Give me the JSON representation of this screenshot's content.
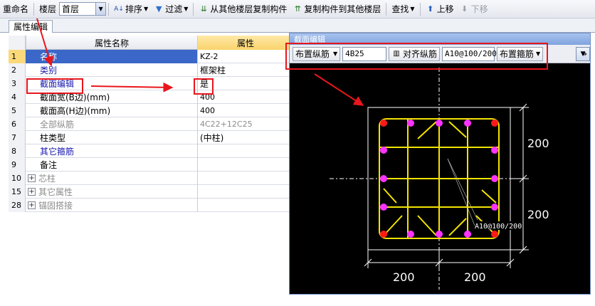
{
  "toolbar": {
    "rename": "重命名",
    "floor_label": "楼层",
    "floor_value": "首层",
    "sort": "排序",
    "filter": "过滤",
    "copy_from": "从其他楼层复制构件",
    "copy_to": "复制构件到其他楼层",
    "find": "查找",
    "move_up": "上移",
    "move_down": "下移"
  },
  "tab": {
    "label": "属性编辑"
  },
  "grid": {
    "header_name": "属性名称",
    "header_value": "属性",
    "rows": [
      {
        "no": "1",
        "name": "名称",
        "value": "KZ-2"
      },
      {
        "no": "2",
        "name": "类别",
        "value": "框架柱"
      },
      {
        "no": "3",
        "name": "截面编辑",
        "value": "是"
      },
      {
        "no": "4",
        "name": "截面宽(B边)(mm)",
        "value": "400"
      },
      {
        "no": "5",
        "name": "截面高(H边)(mm)",
        "value": "400"
      },
      {
        "no": "6",
        "name": "全部纵筋",
        "value": "4C22+12C25"
      },
      {
        "no": "7",
        "name": "柱类型",
        "value": "(中柱)"
      },
      {
        "no": "8",
        "name": "其它箍筋",
        "value": ""
      },
      {
        "no": "9",
        "name": "备注",
        "value": ""
      },
      {
        "no": "10",
        "name": "芯柱",
        "value": ""
      },
      {
        "no": "15",
        "name": "其它属性",
        "value": ""
      },
      {
        "no": "28",
        "name": "锚固搭接",
        "value": ""
      }
    ]
  },
  "editor": {
    "title": "截面编辑",
    "place_long_bar": "布置纵筋",
    "long_bar_value": "4B25",
    "align_long_bar": "对齐纵筋",
    "stirrup_value": "A10@100/200",
    "place_stirrup": "布置箍筋",
    "more": "»"
  },
  "drawing": {
    "dim_right_top": "200",
    "dim_right_bottom": "200",
    "dim_bottom_left": "200",
    "dim_bottom_right": "200",
    "stirrup_label": "A10@100/200",
    "colors": {
      "stirrup": "#f2e300",
      "corner_bar": "#ff1a1a",
      "side_bar": "#ff33ff",
      "dim": "#ffffff",
      "annotation": "#e8161c"
    }
  }
}
